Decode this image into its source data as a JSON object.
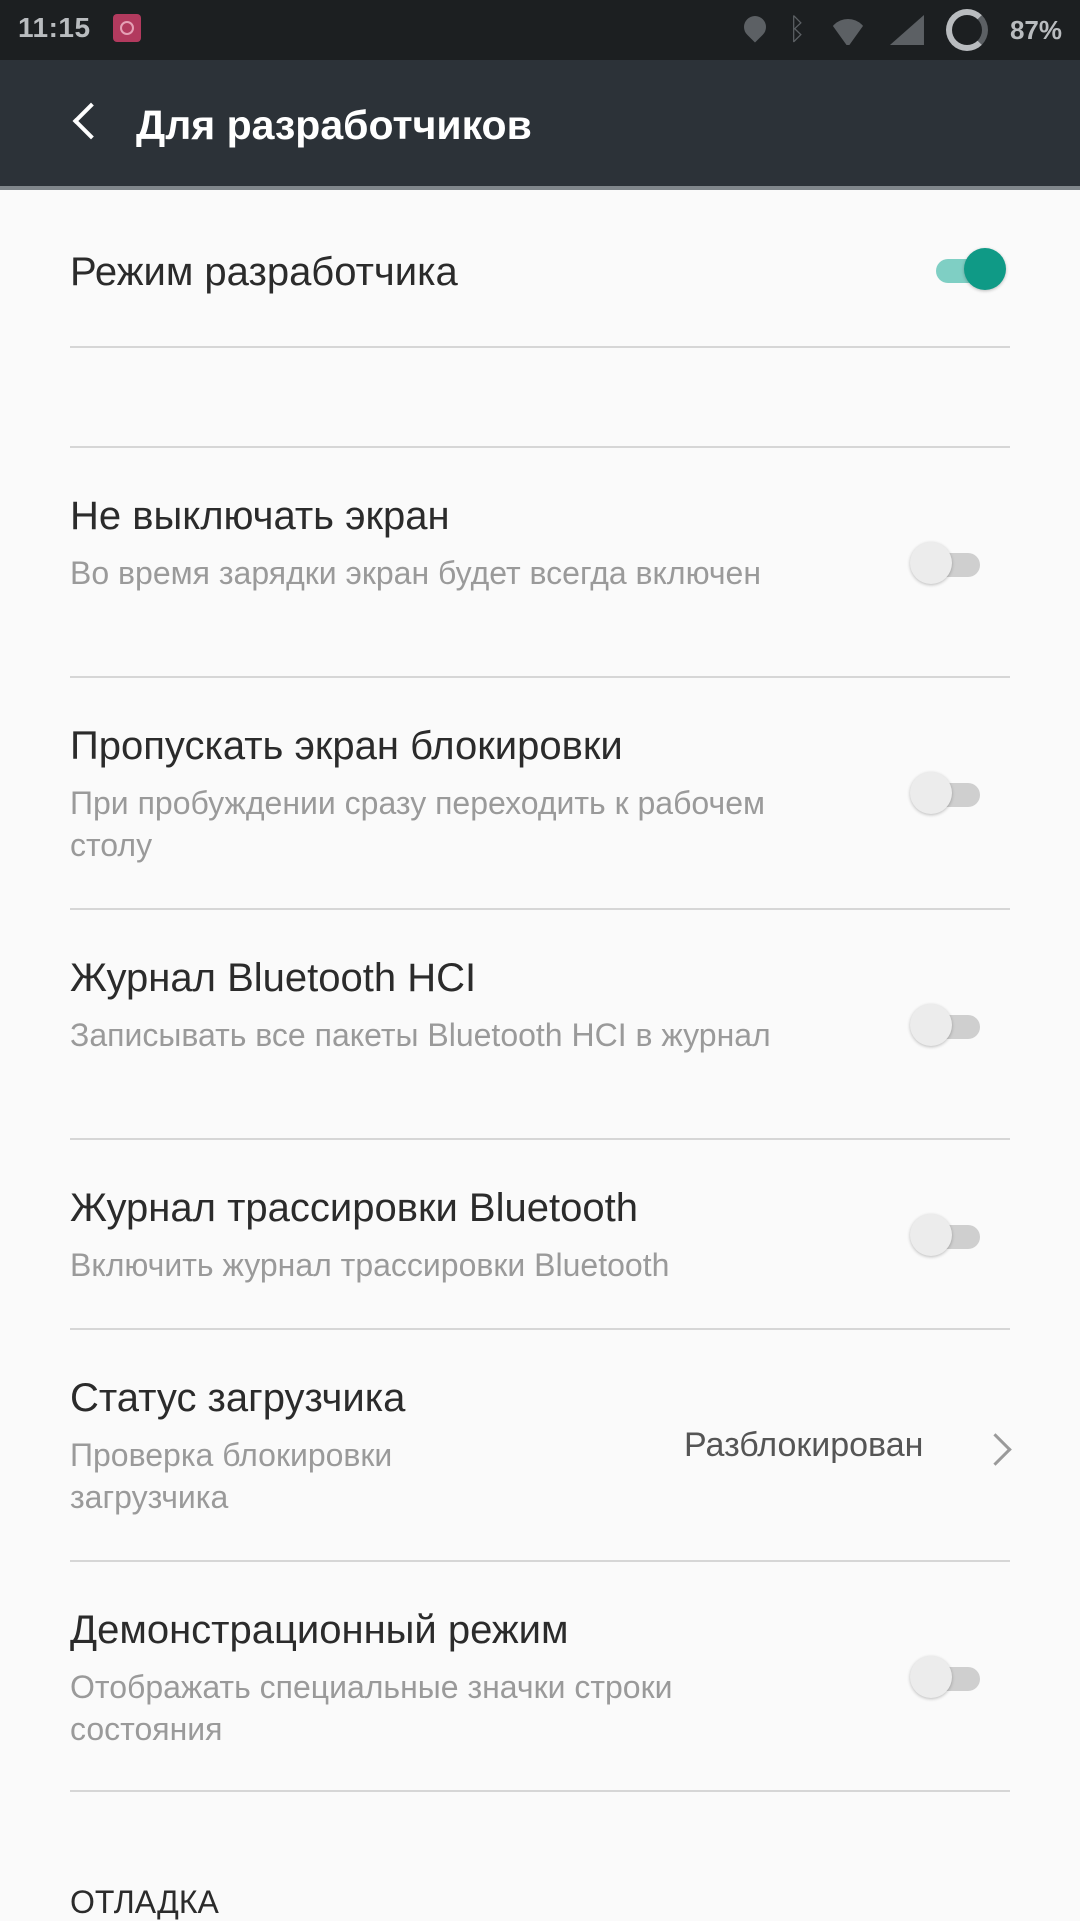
{
  "status_bar": {
    "time": "11:15",
    "battery": "87%",
    "icons": [
      "notification-icon",
      "location-icon",
      "bluetooth-icon",
      "wifi-icon",
      "signal-icon",
      "battery-ring-icon"
    ]
  },
  "app_bar": {
    "title": "Для разработчиков"
  },
  "developer_mode": {
    "label": "Режим разработчика",
    "enabled": true
  },
  "settings": [
    {
      "title": "Не выключать экран",
      "subtitle": "Во время зарядки экран будет всегда включен",
      "enabled": false
    },
    {
      "title": "Пропускать экран блокировки",
      "subtitle": "При пробуждении сразу переходить к рабочем столу",
      "enabled": false
    },
    {
      "title": "Журнал Bluetooth HCI",
      "subtitle": "Записывать все пакеты Bluetooth HCI в журнал",
      "enabled": false
    },
    {
      "title": "Журнал трассировки Bluetooth",
      "subtitle": "Включить журнал трассировки Bluetooth",
      "enabled": false
    },
    {
      "title": "Статус загрузчика",
      "subtitle": "Проверка блокировки загрузчика",
      "value": "Разблокирован"
    },
    {
      "title": "Демонстрационный режим",
      "subtitle": "Отображать специальные значки строки состояния",
      "enabled": false
    }
  ],
  "section": {
    "debug_header": "ОТЛАДКА"
  },
  "colors": {
    "accent": "#0f9a86",
    "app_bar": "#2c3238",
    "status_bar": "#1c1f21"
  }
}
